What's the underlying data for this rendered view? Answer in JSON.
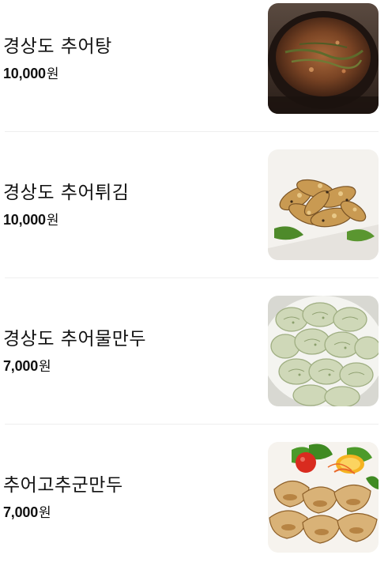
{
  "menu": {
    "items": [
      {
        "name": "경상도 추어탕",
        "price": "10,000",
        "unit": "원",
        "photo": "chueotang-soup-photo"
      },
      {
        "name": "경상도 추어튀김",
        "price": "10,000",
        "unit": "원",
        "photo": "fried-loach-photo"
      },
      {
        "name": "경상도 추어물만두",
        "price": "7,000",
        "unit": "원",
        "photo": "boiled-dumplings-photo"
      },
      {
        "name": "추어고추군만두",
        "price": "7,000",
        "unit": "원",
        "photo": "pan-fried-dumplings-photo"
      }
    ]
  }
}
